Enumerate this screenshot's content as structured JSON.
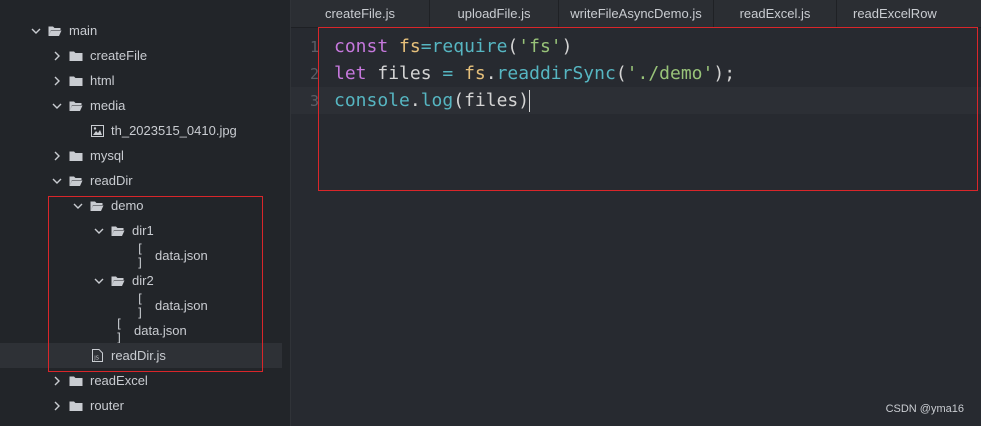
{
  "tree": [
    {
      "label": "main",
      "type": "folder",
      "expanded": true,
      "depth": 0
    },
    {
      "label": "createFile",
      "type": "folder",
      "expanded": false,
      "depth": 1
    },
    {
      "label": "html",
      "type": "folder",
      "expanded": false,
      "depth": 1
    },
    {
      "label": "media",
      "type": "folder",
      "expanded": true,
      "depth": 1
    },
    {
      "label": "th_2023515_0410.jpg",
      "type": "image",
      "depth": 2
    },
    {
      "label": "mysql",
      "type": "folder",
      "expanded": false,
      "depth": 1
    },
    {
      "label": "readDir",
      "type": "folder",
      "expanded": true,
      "depth": 1
    },
    {
      "label": "demo",
      "type": "folder",
      "expanded": true,
      "depth": 2
    },
    {
      "label": "dir1",
      "type": "folder",
      "expanded": true,
      "depth": 3
    },
    {
      "label": "data.json",
      "type": "json",
      "depth": 4
    },
    {
      "label": "dir2",
      "type": "folder",
      "expanded": true,
      "depth": 3
    },
    {
      "label": "data.json",
      "type": "json",
      "depth": 4
    },
    {
      "label": "data.json",
      "type": "json",
      "depth": 3
    },
    {
      "label": "readDir.js",
      "type": "js",
      "depth": 2,
      "selected": true
    },
    {
      "label": "readExcel",
      "type": "folder",
      "expanded": false,
      "depth": 1
    },
    {
      "label": "router",
      "type": "folder",
      "expanded": false,
      "depth": 1
    }
  ],
  "json_glyph": "[ ]",
  "tabs": [
    {
      "label": "createFile.js"
    },
    {
      "label": "uploadFile.js"
    },
    {
      "label": "writeFileAsyncDemo.js"
    },
    {
      "label": "readExcel.js"
    },
    {
      "label": "readExcelRow"
    }
  ],
  "code": {
    "line_numbers": [
      "1",
      "2",
      "3"
    ],
    "lines": [
      [
        {
          "t": "const",
          "c": "kw"
        },
        {
          "t": " ",
          "c": "plain"
        },
        {
          "t": "fs",
          "c": "var"
        },
        {
          "t": "=",
          "c": "op"
        },
        {
          "t": "require",
          "c": "fn"
        },
        {
          "t": "(",
          "c": "punc"
        },
        {
          "t": "'fs'",
          "c": "str"
        },
        {
          "t": ")",
          "c": "punc"
        }
      ],
      [
        {
          "t": "let",
          "c": "kw"
        },
        {
          "t": " files ",
          "c": "plain"
        },
        {
          "t": "=",
          "c": "op"
        },
        {
          "t": " ",
          "c": "plain"
        },
        {
          "t": "fs",
          "c": "var"
        },
        {
          "t": ".",
          "c": "punc"
        },
        {
          "t": "readdirSync",
          "c": "fn"
        },
        {
          "t": "(",
          "c": "punc"
        },
        {
          "t": "'./demo'",
          "c": "str"
        },
        {
          "t": ");",
          "c": "punc"
        }
      ],
      [
        {
          "t": "console",
          "c": "obj"
        },
        {
          "t": ".",
          "c": "punc"
        },
        {
          "t": "log",
          "c": "fn"
        },
        {
          "t": "(",
          "c": "punc"
        },
        {
          "t": "files",
          "c": "plain"
        },
        {
          "t": ")",
          "c": "punc"
        }
      ]
    ]
  },
  "watermark": "CSDN @yma16",
  "colors": {
    "highlight": "#d9262a",
    "folder": "#c9ccd1"
  }
}
